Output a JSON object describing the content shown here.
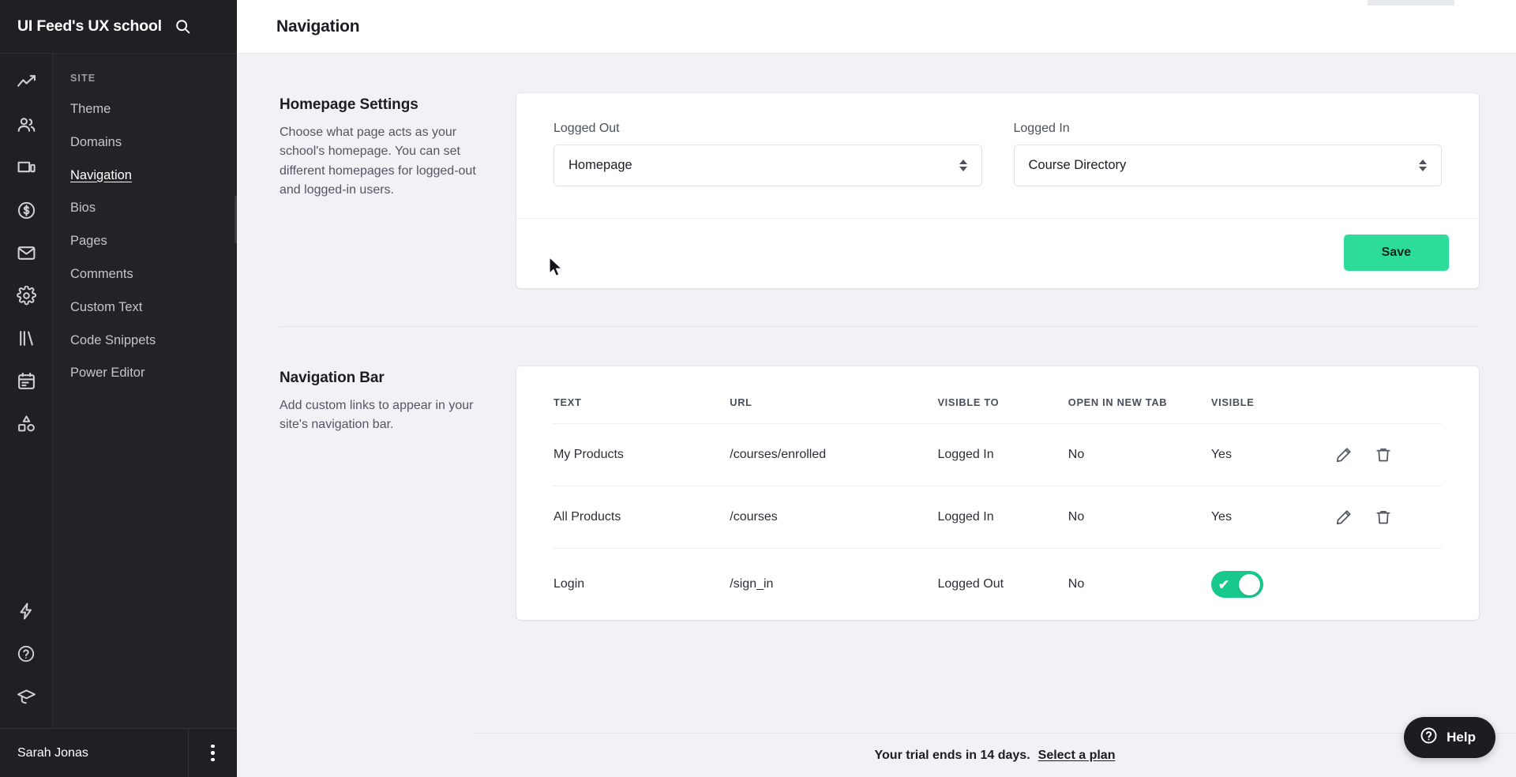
{
  "brand": {
    "title": "UI Feed's UX school",
    "search_icon": "search-icon"
  },
  "rail_icons": [
    {
      "name": "analytics-icon"
    },
    {
      "name": "users-icon"
    },
    {
      "name": "devices-icon"
    },
    {
      "name": "revenue-icon"
    },
    {
      "name": "email-icon"
    },
    {
      "name": "settings-icon"
    },
    {
      "name": "library-icon"
    },
    {
      "name": "calendar-icon"
    },
    {
      "name": "shapes-icon"
    }
  ],
  "rail_bottom_icons": [
    {
      "name": "lightning-icon"
    },
    {
      "name": "help-circle-icon"
    },
    {
      "name": "graduation-cap-icon"
    }
  ],
  "sidebar": {
    "group_label": "SITE",
    "items": [
      {
        "label": "Theme",
        "active": false
      },
      {
        "label": "Domains",
        "active": false
      },
      {
        "label": "Navigation",
        "active": true
      },
      {
        "label": "Bios",
        "active": false
      },
      {
        "label": "Pages",
        "active": false
      },
      {
        "label": "Comments",
        "active": false
      },
      {
        "label": "Custom Text",
        "active": false
      },
      {
        "label": "Code Snippets",
        "active": false
      },
      {
        "label": "Power Editor",
        "active": false
      }
    ]
  },
  "user": {
    "name": "Sarah Jonas",
    "menu_icon": "kebab-menu-icon"
  },
  "header": {
    "title": "Navigation"
  },
  "homepage_settings": {
    "heading": "Homepage Settings",
    "description": "Choose what page acts as your school's homepage. You can set different homepages for logged-out and logged-in users.",
    "logged_out_label": "Logged Out",
    "logged_out_value": "Homepage",
    "logged_in_label": "Logged In",
    "logged_in_value": "Course Directory",
    "save_label": "Save",
    "save_color": "#2edc9a"
  },
  "navigation_bar": {
    "heading": "Navigation Bar",
    "description": "Add custom links to appear in your site's navigation bar.",
    "columns": [
      "TEXT",
      "URL",
      "VISIBLE TO",
      "OPEN IN NEW TAB",
      "VISIBLE"
    ],
    "rows": [
      {
        "text": "My Products",
        "url": "/courses/enrolled",
        "visible_to": "Logged In",
        "open_in_new_tab": "No",
        "visible": "Yes",
        "visible_is_toggle": false
      },
      {
        "text": "All Products",
        "url": "/courses",
        "visible_to": "Logged In",
        "open_in_new_tab": "No",
        "visible": "Yes",
        "visible_is_toggle": false
      },
      {
        "text": "Login",
        "url": "/sign_in",
        "visible_to": "Logged Out",
        "open_in_new_tab": "No",
        "visible": "",
        "visible_is_toggle": true,
        "toggle_on": true,
        "toggle_color": "#19c88b"
      }
    ],
    "edit_icon": "pencil-icon",
    "delete_icon": "trash-icon"
  },
  "trial": {
    "message": "Your trial ends in 14 days.",
    "cta": "Select a plan"
  },
  "help": {
    "label": "Help",
    "icon": "question-circle-icon"
  }
}
